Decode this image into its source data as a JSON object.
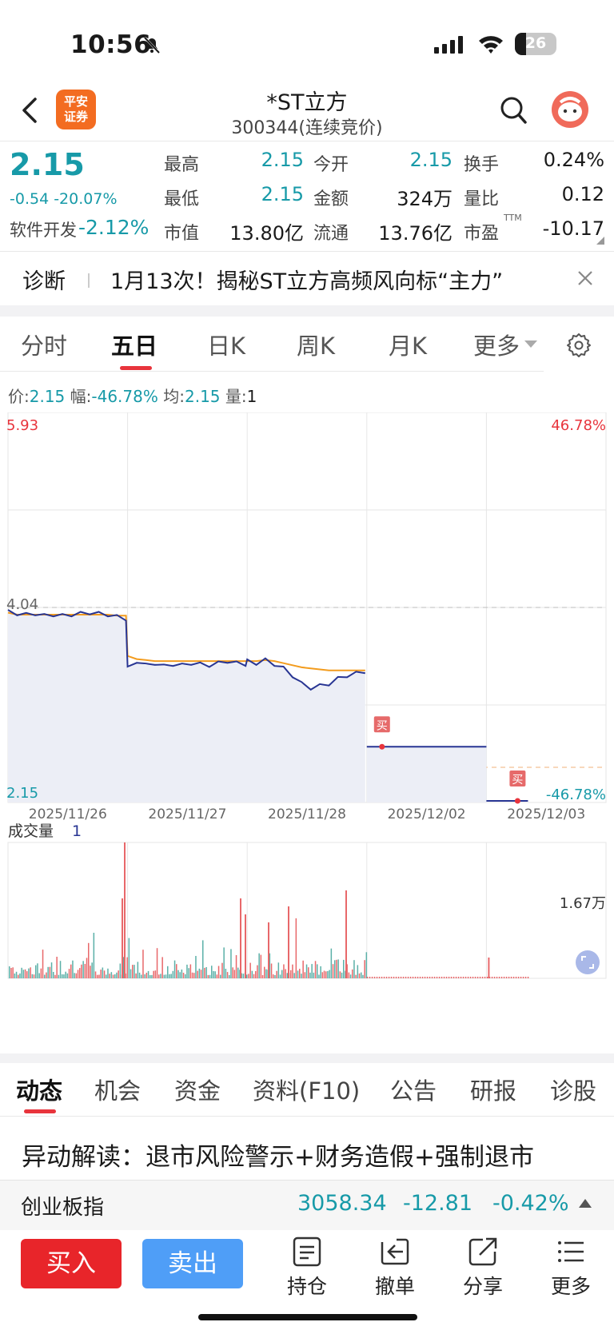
{
  "status_bar": {
    "time": "10:56",
    "battery": "26"
  },
  "header": {
    "logo_line1": "平安",
    "logo_line2": "证券",
    "stock_name": "*ST立方",
    "stock_code": "300344(连续竞价)"
  },
  "quote": {
    "price": "2.15",
    "change": "-0.54 -20.07%",
    "sector": "软件开发",
    "sector_change": "-2.12%",
    "rows": [
      [
        {
          "label": "最高",
          "value": "2.15"
        },
        {
          "label": "今开",
          "value": "2.15"
        },
        {
          "label": "换手",
          "value": "0.24%"
        }
      ],
      [
        {
          "label": "最低",
          "value": "2.15"
        },
        {
          "label": "金额",
          "value": "324万"
        },
        {
          "label": "量比",
          "value": "0.12"
        }
      ],
      [
        {
          "label": "市值",
          "value": "13.80亿"
        },
        {
          "label": "流通",
          "value": "13.76亿"
        },
        {
          "label": "市盈",
          "value": "-10.17"
        }
      ]
    ],
    "pe_sup": "TTM"
  },
  "diagnosis": {
    "label": "诊断",
    "text": "1月13次！揭秘ST立方高频风向标“主力”"
  },
  "chart_tabs": [
    {
      "label": "分时",
      "active": false
    },
    {
      "label": "五日",
      "active": true
    },
    {
      "label": "日K",
      "active": false
    },
    {
      "label": "周K",
      "active": false
    },
    {
      "label": "月K",
      "active": false
    },
    {
      "label": "更多",
      "active": false
    }
  ],
  "info_line": {
    "price_label": "价:",
    "price": "2.15",
    "range_label": "幅:",
    "range": "-46.78%",
    "avg_label": "均:",
    "avg": "2.15",
    "vol_label": "量:",
    "vol": "1"
  },
  "chart_data": {
    "type": "line",
    "dates": [
      "2025/11/26",
      "2025/11/27",
      "2025/11/28",
      "2025/12/02",
      "2025/12/03"
    ],
    "y_max_label": "5.93",
    "y_mid_label": "4.04",
    "y_min_label": "2.15",
    "pct_max_label": "46.78%",
    "pct_min_label": "-46.78%",
    "ylim": [
      2.15,
      5.93
    ],
    "prev_close": 4.04,
    "series": [
      {
        "values": [
          4.0,
          3.98,
          3.97,
          3.98,
          3.96,
          3.97,
          3.96,
          3.97,
          3.98,
          3.99,
          3.98,
          3.97,
          3.95,
          3.93,
          3.45,
          3.52,
          3.48,
          3.5,
          3.47,
          3.49,
          3.48,
          3.5,
          3.49,
          3.48,
          3.5,
          3.52,
          3.5,
          3.49,
          3.52,
          3.5,
          3.53,
          3.49,
          3.45,
          3.38,
          3.3,
          3.26,
          3.28,
          3.3,
          3.35,
          3.38,
          3.4,
          3.42,
          2.69,
          2.69,
          2.69,
          2.69,
          2.69,
          2.69,
          2.69,
          2.69,
          2.69,
          2.69,
          2.69,
          2.69,
          2.69,
          2.69,
          2.15,
          2.15,
          2.15,
          2.15,
          2.15,
          2.15,
          2.15
        ]
      },
      {
        "values": [
          3.99,
          3.97,
          3.97,
          3.97,
          3.97,
          3.97,
          3.97,
          3.97,
          3.97,
          3.97,
          3.97,
          3.97,
          3.96,
          3.96,
          3.57,
          3.54,
          3.53,
          3.52,
          3.52,
          3.52,
          3.52,
          3.52,
          3.52,
          3.52,
          3.52,
          3.52,
          3.52,
          3.52,
          3.52,
          3.52,
          3.53,
          3.52,
          3.5,
          3.48,
          3.46,
          3.45,
          3.44,
          3.43,
          3.43,
          3.43,
          3.43,
          3.43
        ]
      }
    ],
    "buy_marker_label": "买",
    "volume_label": "成交量",
    "volume_value": "1",
    "volume_max_label": "1.67万"
  },
  "news_tabs": [
    {
      "label": "动态",
      "active": true
    },
    {
      "label": "机会",
      "active": false
    },
    {
      "label": "资金",
      "active": false
    },
    {
      "label": "资料(F10)",
      "active": false
    },
    {
      "label": "公告",
      "active": false
    },
    {
      "label": "研报",
      "active": false
    },
    {
      "label": "诊股",
      "active": false
    }
  ],
  "news_headline": "异动解读：退市风险警示+财务造假+强制退市",
  "index_bar": {
    "name": "创业板指",
    "value": "3058.34",
    "change": "-12.81",
    "pct": "-0.42%"
  },
  "actions": {
    "buy": "买入",
    "sell": "卖出",
    "items": [
      {
        "label": "持仓",
        "icon": "position-icon"
      },
      {
        "label": "撤单",
        "icon": "cancel-order-icon"
      },
      {
        "label": "分享",
        "icon": "share-icon"
      },
      {
        "label": "更多",
        "icon": "menu-icon"
      }
    ]
  },
  "colors": {
    "teal": "#179aa8",
    "red": "#e8343c",
    "price_line": "#283593",
    "avg_line": "#f39c1e",
    "sell": "#4f9ef7"
  }
}
